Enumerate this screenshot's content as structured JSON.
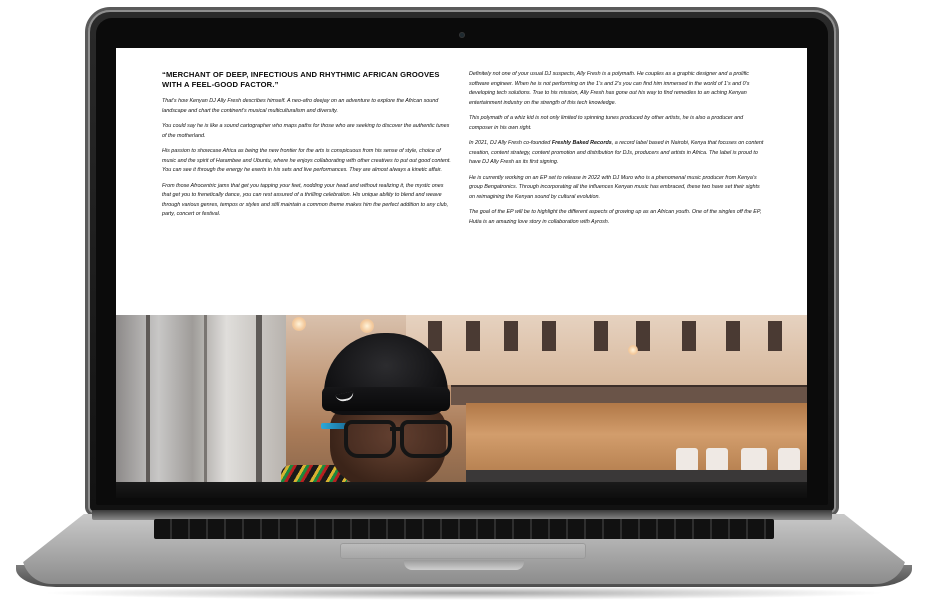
{
  "article": {
    "headline": "“MERCHANT OF DEEP, INFECTIOUS AND RHYTHMIC AFRICAN GROOVES WITH A FEEL-GOOD FACTOR.”",
    "left_paragraphs": [
      "That’s how Kenyan DJ Ally Fresh describes himself. A neo-afro deejay on an adventure to explore the African sound landscape and chart the continent’s musical multiculturalism and diversity.",
      "You could say he is like a sound cartographer who maps paths for those who are seeking to discover the authentic tunes of the motherland.",
      "His passion to showcase Africa as being the new frontier for the arts is conspicuous from his sense of style, choice of music and the spirit of Harambee and Ubuntu, where he enjoys collaborating with other creatives to put out good content. You can see it through the energy he exerts in his sets and live performances. They are almost always a kinetic affair.",
      "From those Afrocentric jams that get you tapping your feet, nodding your head and without realizing it, the mystic ones that get you to frenetically dance, you can rest assured of a thrilling celebration. His unique ability to blend and weave through various genres, tempos or styles and still maintain a common theme makes him the perfect addition to any club, party, concert or festival."
    ],
    "right_p1": "Definitely not one of your usual DJ suspects, Ally Fresh is a polymath. He couples as a graphic designer and a prolific software engineer. When he is not performing on the 1’s and 2’s you can find him immersed in the world of 1’s and 0’s developing tech solutions. True to his mission, Ally Fresh has gone out his way to find remedies to an aching Kenyan entertainment industry on the strength of this tech knowledge.",
    "right_p2": "This polymath of a whiz kid is not only limited to spinning tunes produced by other artists, he is also a producer and composer in his own right.",
    "right_p3_before": "In 2021, DJ Ally Fresh co-founded ",
    "right_p3_bold": "Freshly Baked Records",
    "right_p3_after": ", a record label based in Nairobi, Kenya that focuses on content creation, content strategy, content promotion and distribution for DJs, producers and artists in Africa. The label is proud to have DJ Ally Fresh as its first signing.",
    "right_p4": "He is currently working on an EP set to release in 2022 with DJ Muro who is a phenomenal music producer from Kenya’s group Bengatronics. Through incorporating all the influences Kenyan music has embraced, these two have set their sights on reimagining the Kenyan sound by cultural evolution.",
    "right_p5": "The goal of the EP will be to highlight the different aspects of growing up as an African youth. One of the singles off the EP, Hutia is an amazing love story in collaboration with Ayrosh."
  },
  "photo": {
    "subject": "DJ portrait photo",
    "colors": {
      "beanie": "#111113",
      "facade": "#d7b89c",
      "shop": "#b17847"
    }
  },
  "device": {
    "frame_color": "#121212",
    "base_color": "#a8a8a8"
  }
}
